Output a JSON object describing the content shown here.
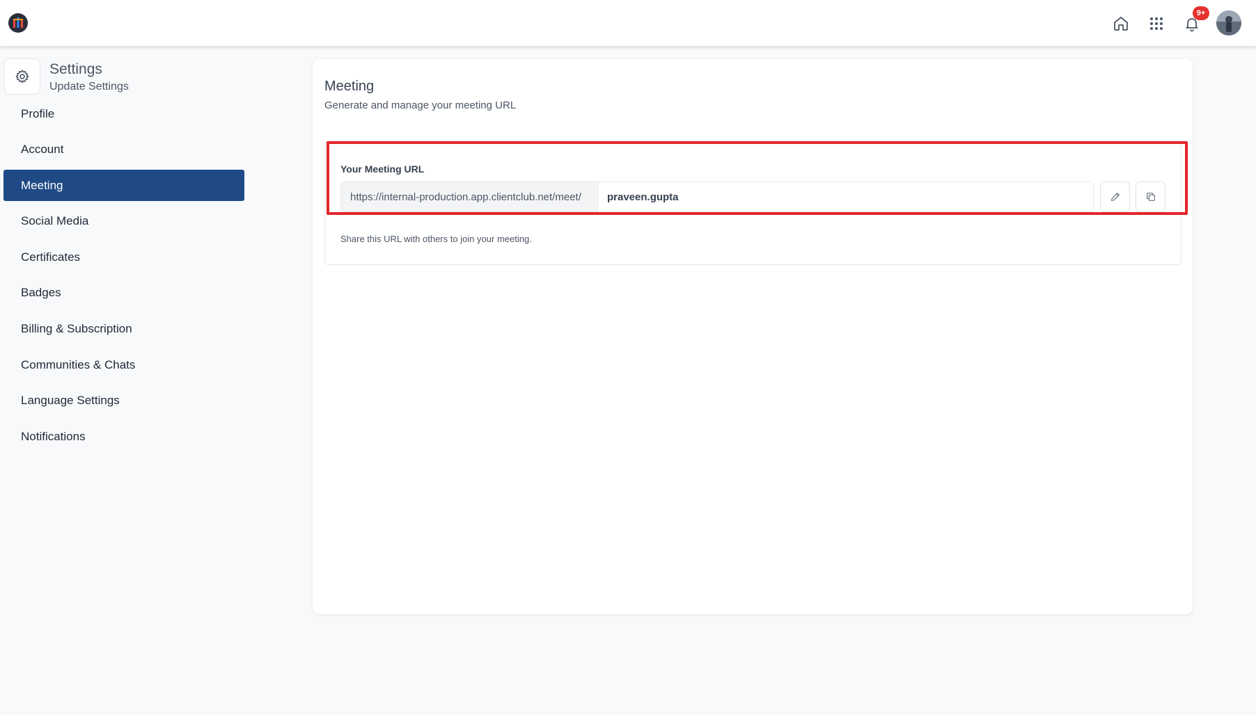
{
  "topbar": {
    "logo_icon": "brand-logo-icon",
    "icons": [
      "home-icon",
      "apps-grid-icon",
      "bell-icon"
    ],
    "notification_badge": "9+",
    "badge_color": "#e5322d"
  },
  "sidebar": {
    "title": "Settings",
    "subtitle": "Update Settings",
    "items": [
      {
        "label": "Profile"
      },
      {
        "label": "Account"
      },
      {
        "label": "Meeting"
      },
      {
        "label": "Social Media"
      },
      {
        "label": "Certificates"
      },
      {
        "label": "Badges"
      },
      {
        "label": "Billing & Subscription"
      },
      {
        "label": "Communities & Chats"
      },
      {
        "label": "Language Settings"
      },
      {
        "label": "Notifications"
      }
    ],
    "active_item": "Meeting",
    "active_color": "#1f4a85"
  },
  "main": {
    "title": "Meeting",
    "subtitle": "Generate and manage your meeting URL",
    "url_label": "Your Meeting URL",
    "url_prefix": "https://internal-production.app.clientclub.net/meet/",
    "url_slug": "praveen.gupta",
    "help_text": "Share this URL with others to join your meeting.",
    "highlight_color": "#e3262b"
  }
}
